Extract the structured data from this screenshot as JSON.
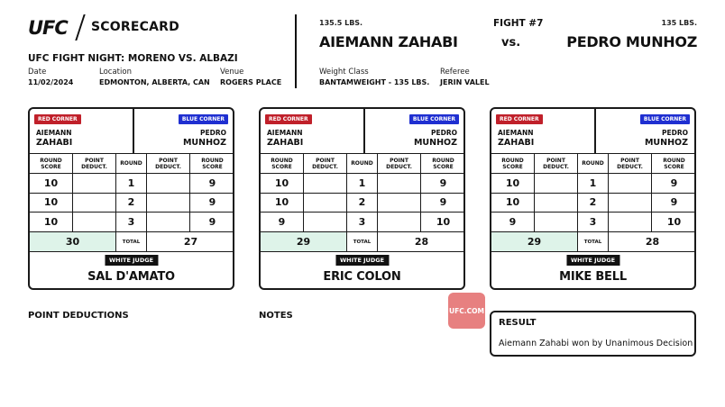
{
  "header": {
    "logo": "UFC",
    "title": "SCORECARD",
    "event": "UFC FIGHT NIGHT: MORENO VS. ALBAZI",
    "date_label": "Date",
    "date": "11/02/2024",
    "location_label": "Location",
    "location": "EDMONTON, ALBERTA, CAN",
    "venue_label": "Venue",
    "venue": "ROGERS PLACE"
  },
  "fight": {
    "fight_number": "FIGHT #7",
    "vs": "vs.",
    "red_weight": "135.5 LBS.",
    "red_name": "AIEMANN ZAHABI",
    "blue_weight": "135 LBS.",
    "blue_name": "PEDRO MUNHOZ",
    "weight_class_label": "Weight Class",
    "weight_class": "BANTAMWEIGHT - 135 LBS.",
    "referee_label": "Referee",
    "referee": "JERIN VALEL"
  },
  "labels": {
    "red_corner": "RED CORNER",
    "blue_corner": "BLUE CORNER",
    "round_score_1": "ROUND",
    "round_score_2": "SCORE",
    "point_deduct_1": "POINT",
    "point_deduct_2": "DEDUCT.",
    "round": "ROUND",
    "total": "TOTAL",
    "white_judge": "WHITE JUDGE",
    "red_first": "AIEMANN",
    "red_last": "ZAHABI",
    "blue_first": "PEDRO",
    "blue_last": "MUNHOZ"
  },
  "judges": [
    {
      "name": "SAL D'AMATO",
      "rounds": [
        {
          "round": "1",
          "red": "10",
          "blue": "9"
        },
        {
          "round": "2",
          "red": "10",
          "blue": "9"
        },
        {
          "round": "3",
          "red": "10",
          "blue": "9"
        }
      ],
      "red_total": "30",
      "blue_total": "27"
    },
    {
      "name": "ERIC COLON",
      "rounds": [
        {
          "round": "1",
          "red": "10",
          "blue": "9"
        },
        {
          "round": "2",
          "red": "10",
          "blue": "9"
        },
        {
          "round": "3",
          "red": "9",
          "blue": "10"
        }
      ],
      "red_total": "29",
      "blue_total": "28"
    },
    {
      "name": "MIKE BELL",
      "rounds": [
        {
          "round": "1",
          "red": "10",
          "blue": "9"
        },
        {
          "round": "2",
          "red": "10",
          "blue": "9"
        },
        {
          "round": "3",
          "red": "9",
          "blue": "10"
        }
      ],
      "red_total": "29",
      "blue_total": "28"
    }
  ],
  "footer": {
    "point_deductions": "POINT DEDUCTIONS",
    "notes": "NOTES",
    "ufc_com": "UFC.COM",
    "result_title": "RESULT",
    "result_text": "Aiemann Zahabi won by Unanimous Decision"
  },
  "colors": {
    "red_corner": "#c0202a",
    "blue_corner": "#1f2fd1",
    "winner_highlight": "#def3e9",
    "ufc_com_badge": "#e78080"
  }
}
